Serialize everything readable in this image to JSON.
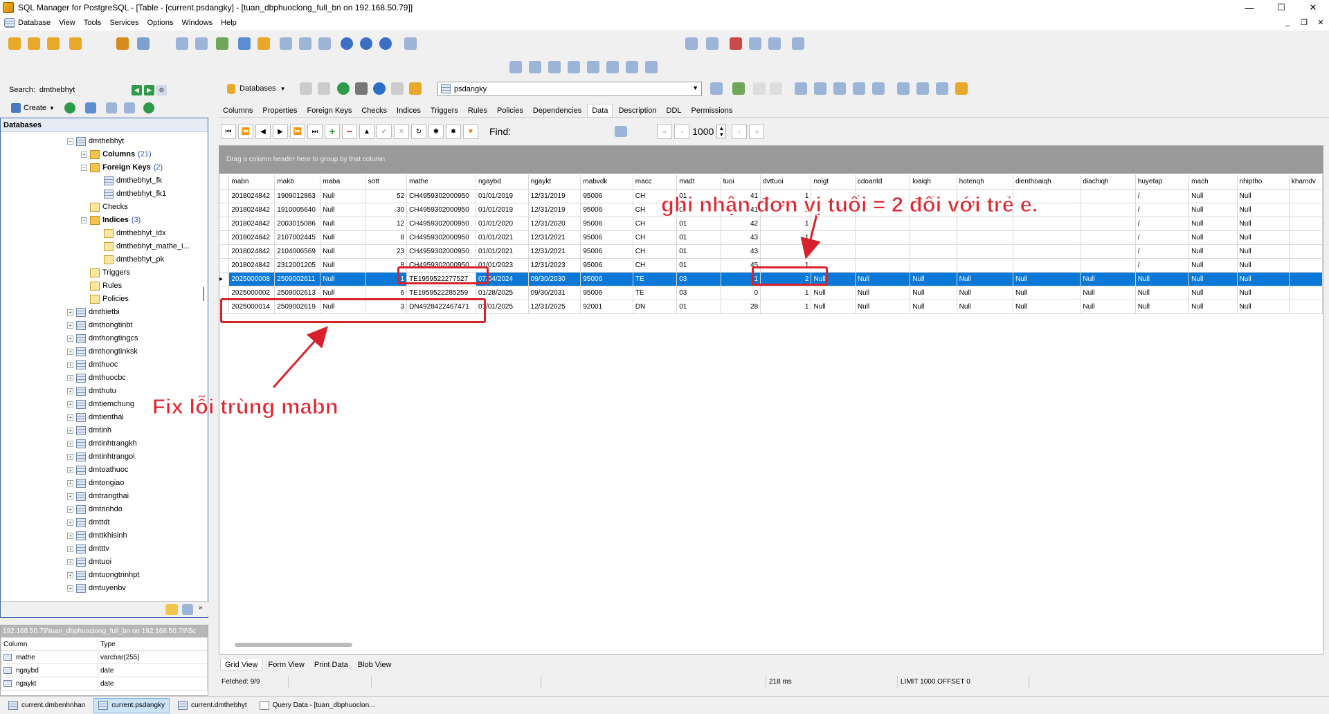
{
  "window": {
    "title": "SQL Manager for PostgreSQL - [Table - [current.psdangky] - [tuan_dbphuoclong_full_bn on 192.168.50.79]]",
    "minimize": "—",
    "maximize": "☐",
    "close": "✕"
  },
  "menu": [
    "Database",
    "View",
    "Tools",
    "Services",
    "Options",
    "Windows",
    "Help"
  ],
  "mdi_controls": {
    "minimize": "_",
    "restore": "❐",
    "close": "✕"
  },
  "explorer": {
    "search_label": "Search:",
    "search_value": "dmthebhyt",
    "create_label": "Create",
    "header": "Databases",
    "tree": [
      {
        "label": "dmthebhyt",
        "depth": 0,
        "toggle": "−",
        "icon": "table"
      },
      {
        "label": "Columns",
        "count": "(21)",
        "depth": 1,
        "toggle": "+",
        "icon": "folder",
        "bold": true
      },
      {
        "label": "Foreign Keys",
        "count": "(2)",
        "depth": 1,
        "toggle": "−",
        "icon": "folder",
        "bold": true
      },
      {
        "label": "dmthebhyt_fk",
        "depth": 2,
        "icon": "fk"
      },
      {
        "label": "dmthebhyt_fk1",
        "depth": 2,
        "icon": "fk"
      },
      {
        "label": "Checks",
        "depth": 1,
        "icon": "obj"
      },
      {
        "label": "Indices",
        "count": "(3)",
        "depth": 1,
        "toggle": "−",
        "icon": "folder",
        "bold": true
      },
      {
        "label": "dmthebhyt_idx",
        "depth": 2,
        "icon": "obj"
      },
      {
        "label": "dmthebhyt_mathe_i...",
        "depth": 2,
        "icon": "obj"
      },
      {
        "label": "dmthebhyt_pk",
        "depth": 2,
        "icon": "obj"
      },
      {
        "label": "Triggers",
        "depth": 1,
        "icon": "obj"
      },
      {
        "label": "Rules",
        "depth": 1,
        "icon": "obj"
      },
      {
        "label": "Policies",
        "depth": 1,
        "icon": "obj"
      },
      {
        "label": "dmthietbi",
        "depth": 0,
        "toggle": "+",
        "icon": "table"
      },
      {
        "label": "dmthongtinbt",
        "depth": 0,
        "toggle": "+",
        "icon": "table"
      },
      {
        "label": "dmthongtingcs",
        "depth": 0,
        "toggle": "+",
        "icon": "table"
      },
      {
        "label": "dmthongtinksk",
        "depth": 0,
        "toggle": "+",
        "icon": "table"
      },
      {
        "label": "dmthuoc",
        "depth": 0,
        "toggle": "+",
        "icon": "table"
      },
      {
        "label": "dmthuocbc",
        "depth": 0,
        "toggle": "+",
        "icon": "table"
      },
      {
        "label": "dmthutu",
        "depth": 0,
        "toggle": "+",
        "icon": "table"
      },
      {
        "label": "dmtiemchung",
        "depth": 0,
        "toggle": "+",
        "icon": "table"
      },
      {
        "label": "dmtienthai",
        "depth": 0,
        "toggle": "+",
        "icon": "table"
      },
      {
        "label": "dmtinh",
        "depth": 0,
        "toggle": "+",
        "icon": "table"
      },
      {
        "label": "dmtinhtrangkh",
        "depth": 0,
        "toggle": "+",
        "icon": "table"
      },
      {
        "label": "dmtinhtrangoi",
        "depth": 0,
        "toggle": "+",
        "icon": "table"
      },
      {
        "label": "dmtoathuoc",
        "depth": 0,
        "toggle": "+",
        "icon": "table"
      },
      {
        "label": "dmtongiao",
        "depth": 0,
        "toggle": "+",
        "icon": "table"
      },
      {
        "label": "dmtrangthai",
        "depth": 0,
        "toggle": "+",
        "icon": "table"
      },
      {
        "label": "dmtrinhdo",
        "depth": 0,
        "toggle": "+",
        "icon": "table"
      },
      {
        "label": "dmttdt",
        "depth": 0,
        "toggle": "+",
        "icon": "table"
      },
      {
        "label": "dmttkhisinh",
        "depth": 0,
        "toggle": "+",
        "icon": "table"
      },
      {
        "label": "dmtttv",
        "depth": 0,
        "toggle": "+",
        "icon": "table"
      },
      {
        "label": "dmtuoi",
        "depth": 0,
        "toggle": "+",
        "icon": "table"
      },
      {
        "label": "dmtuongtrinhpt",
        "depth": 0,
        "toggle": "+",
        "icon": "table"
      },
      {
        "label": "dmtuyenbv",
        "depth": 0,
        "toggle": "+",
        "icon": "table"
      }
    ]
  },
  "props": {
    "header": "192.168.50.79\\tuan_dbphuoclong_full_bn on 192.168.50.79\\Sc",
    "col_header": "Column",
    "type_header": "Type",
    "rows": [
      {
        "column": "mathe",
        "type": "varchar(255)"
      },
      {
        "column": "ngaybd",
        "type": "date"
      },
      {
        "column": "ngaykt",
        "type": "date"
      }
    ]
  },
  "bottom_tabs": [
    {
      "label": "current.dmbenhnhan",
      "active": false
    },
    {
      "label": "current.psdangky",
      "active": true
    },
    {
      "label": "current.dmthebhyt",
      "active": false
    },
    {
      "label": "Query Data - [tuan_dbphuoclon...",
      "active": false
    }
  ],
  "editor": {
    "databases_btn": "Databases",
    "object": "psdangky",
    "tabs": [
      "Columns",
      "Properties",
      "Foreign Keys",
      "Checks",
      "Indices",
      "Triggers",
      "Rules",
      "Policies",
      "Dependencies",
      "Data",
      "Description",
      "DDL",
      "Permissions"
    ],
    "active_tab": "Data",
    "find_label": "Find:",
    "limit": "1000",
    "group_hint": "Drag a column header here to group by that column",
    "view_tabs": [
      "Grid View",
      "Form View",
      "Print Data",
      "Blob View"
    ],
    "active_view": "Grid View",
    "status": {
      "fetched": "Fetched: 9/9",
      "time": "218 ms",
      "limit": "LIMIT 1000 OFFSET 0"
    }
  },
  "grid": {
    "columns": [
      "mabn",
      "makb",
      "maba",
      "sott",
      "mathe",
      "ngaybd",
      "ngaykt",
      "mabvdk",
      "macc",
      "madt",
      "tuoi",
      "dvttuoi",
      "noigt",
      "cdoantd",
      "loaiqh",
      "hotenqh",
      "dienthoaiqh",
      "diachiqh",
      "huyetap",
      "mach",
      "nhiptho",
      "khamdv"
    ],
    "rows": [
      [
        "2018024842",
        "1909012863",
        "Null",
        "52",
        "CH4959302000950",
        "01/01/2019",
        "12/31/2019",
        "95006",
        "CH",
        "01",
        "41",
        "1",
        "",
        "",
        "",
        "",
        "",
        "",
        "/",
        "Null",
        "Null",
        ""
      ],
      [
        "2018024842",
        "1910005640",
        "Null",
        "30",
        "CH4959302000950",
        "01/01/2019",
        "12/31/2019",
        "95006",
        "CH",
        "01",
        "41",
        "1",
        "",
        "",
        "",
        "",
        "",
        "",
        "/",
        "Null",
        "Null",
        ""
      ],
      [
        "2018024842",
        "2003015086",
        "Null",
        "12",
        "CH4959302000950",
        "01/01/2020",
        "12/31/2020",
        "95006",
        "CH",
        "01",
        "42",
        "1",
        "",
        "",
        "",
        "",
        "",
        "",
        "/",
        "Null",
        "Null",
        ""
      ],
      [
        "2018024842",
        "2107002445",
        "Null",
        "8",
        "CH4959302000950",
        "01/01/2021",
        "12/31/2021",
        "95006",
        "CH",
        "01",
        "43",
        "1",
        "",
        "",
        "",
        "",
        "",
        "",
        "/",
        "Null",
        "Null",
        ""
      ],
      [
        "2018024842",
        "2104006569",
        "Null",
        "23",
        "CH4959302000950",
        "01/01/2021",
        "12/31/2021",
        "95006",
        "CH",
        "01",
        "43",
        "1",
        "",
        "",
        "",
        "",
        "",
        "",
        "/",
        "Null",
        "Null",
        ""
      ],
      [
        "2018024842",
        "2312001205",
        "Null",
        "8",
        "CH4959302000950",
        "01/01/2023",
        "12/31/2023",
        "95006",
        "CH",
        "01",
        "45",
        "1",
        "",
        "",
        "",
        "",
        "",
        "",
        "/",
        "Null",
        "Null",
        ""
      ],
      [
        "2025000008",
        "2509002611",
        "Null",
        "1",
        "TE1959522277527",
        "07/04/2024",
        "09/30/2030",
        "95006",
        "TE",
        "03",
        "1",
        "2",
        "Null",
        "Null",
        "Null",
        "Null",
        "Null",
        "Null",
        "Null",
        "Null",
        "Null",
        ""
      ],
      [
        "2025000002",
        "2509002613",
        "Null",
        "6",
        "TE1959522285259",
        "01/28/2025",
        "09/30/2031",
        "95006",
        "TE",
        "03",
        "0",
        "1",
        "Null",
        "Null",
        "Null",
        "Null",
        "Null",
        "Null",
        "Null",
        "Null",
        "Null",
        ""
      ],
      [
        "2025000014",
        "2509002619",
        "Null",
        "3",
        "DN4928422467471",
        "01/01/2025",
        "12/31/2025",
        "92001",
        "DN",
        "01",
        "28",
        "1",
        "Null",
        "Null",
        "Null",
        "Null",
        "Null",
        "Null",
        "Null",
        "Null",
        "Null",
        ""
      ]
    ],
    "selected_row": 6
  },
  "annotations": {
    "note_dvttuoi": "ghi nhận đơn vị tuổi = 2 đối với trẻ e.",
    "note_mabn": "Fix lỗi trùng mabn",
    "color": "#e2252f"
  },
  "colors": {
    "selection": "#0a78d6",
    "accent": "#3e6ab0",
    "annotation": "#d9212b"
  }
}
